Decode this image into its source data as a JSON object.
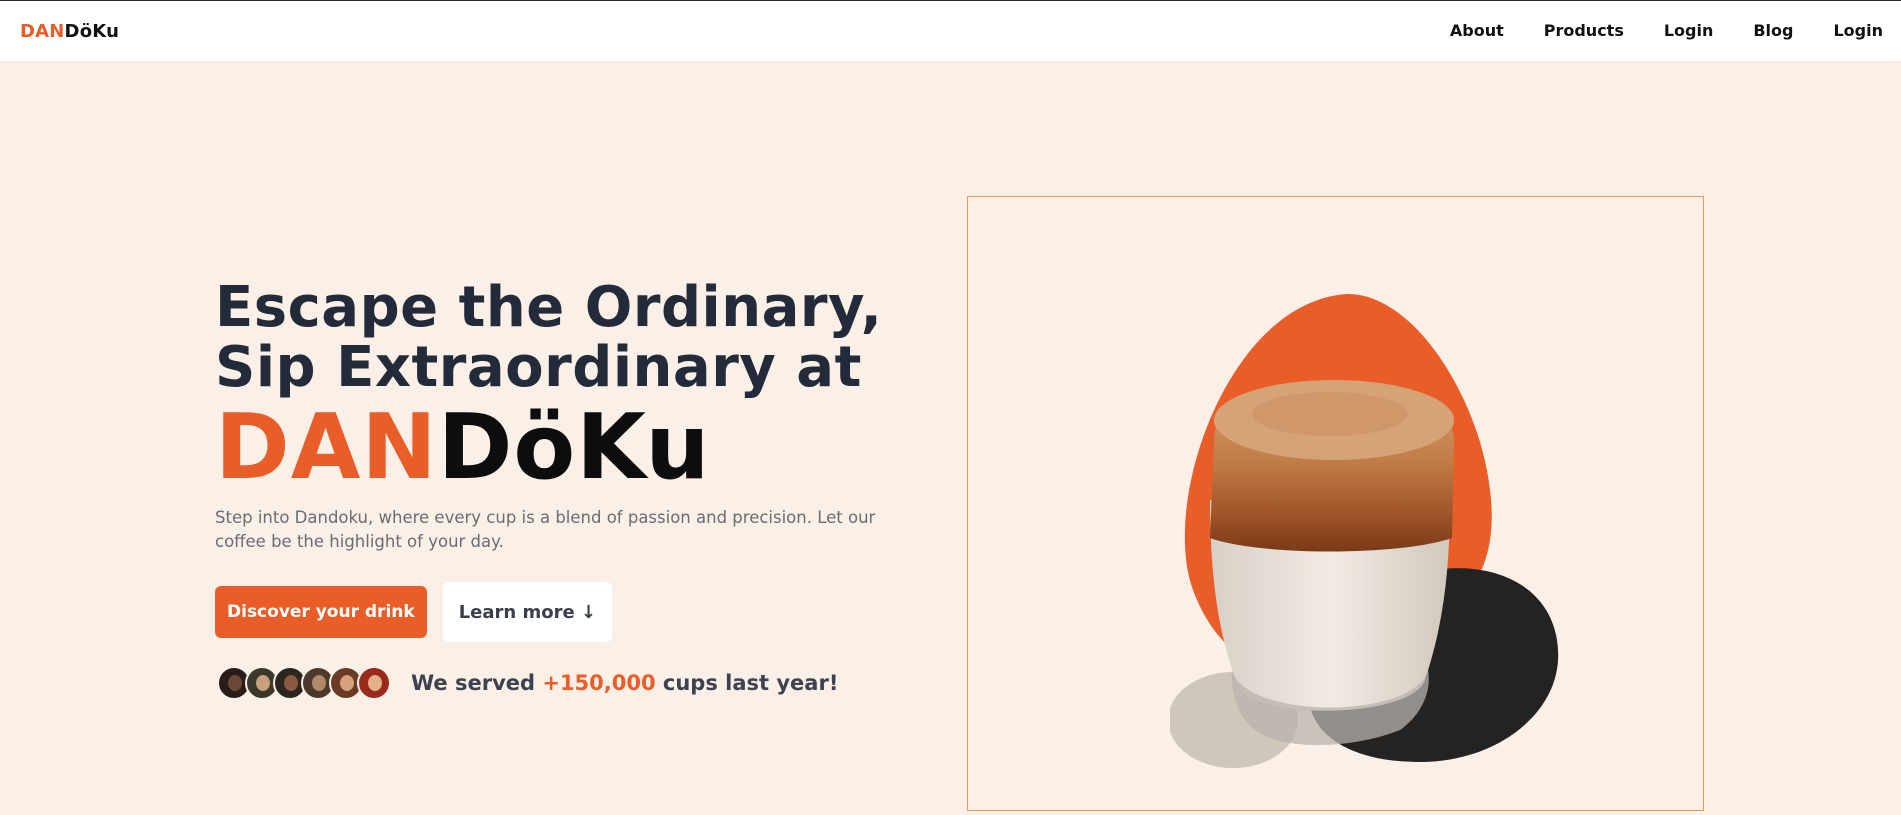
{
  "header": {
    "logo_part1": "DAN",
    "logo_part2": "DöKu",
    "nav": [
      "About",
      "Products",
      "Login",
      "Blog",
      "Login"
    ]
  },
  "hero": {
    "headline_line1": "Escape the Ordinary,",
    "headline_line2": "Sip Extraordinary at",
    "brand_part1": "DAN",
    "brand_part2": "DöKu",
    "lead": "Step into Dandoku, where every cup is a blend of passion and precision. Let our coffee be the highlight of your day.",
    "primary_button": "Discover your drink",
    "secondary_button": "Learn more ↓",
    "served_prefix": "We served ",
    "served_count": "+150,000",
    "served_suffix": " cups last year!"
  },
  "colors": {
    "accent": "#e95e28",
    "background": "#fbf0e7",
    "dark_text": "#232a39",
    "frame_border": "#ee9a5c"
  },
  "avatars": [
    {
      "hair": "#2a1d18",
      "face": "#6a4a36"
    },
    {
      "hair": "#3b3a2a",
      "face": "#c7a07e"
    },
    {
      "hair": "#2c2620",
      "face": "#8a5a40"
    },
    {
      "hair": "#4b3a2c",
      "face": "#b1886a"
    },
    {
      "hair": "#6b3a24",
      "face": "#d5a07c"
    },
    {
      "hair": "#9a2a1c",
      "face": "#e3b08a"
    }
  ]
}
